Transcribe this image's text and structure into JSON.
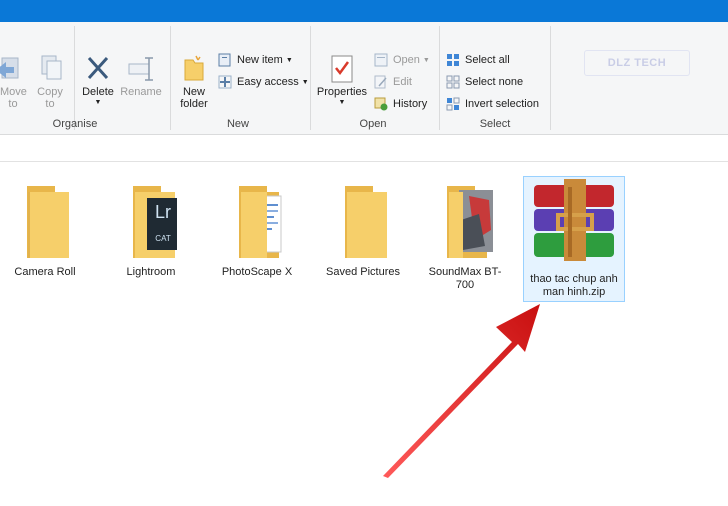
{
  "ribbon": {
    "clipboard_group": {
      "move_to": "Move to",
      "copy_to": "Copy to",
      "label": "Organise"
    },
    "organise": {
      "delete": "Delete",
      "rename": "Rename"
    },
    "new_group": {
      "new_folder": "New folder",
      "new_item": "New item",
      "easy_access": "Easy access",
      "label": "New"
    },
    "open_group": {
      "properties": "Properties",
      "open": "Open",
      "edit": "Edit",
      "history": "History",
      "label": "Open"
    },
    "select_group": {
      "select_all": "Select all",
      "select_none": "Select none",
      "invert_selection": "Invert selection",
      "label": "Select"
    }
  },
  "watermark": "DLZ TECH",
  "files": [
    {
      "name": "Camera Roll",
      "type": "folder"
    },
    {
      "name": "Lightroom",
      "type": "folder",
      "overlay": "Lr CAT"
    },
    {
      "name": "PhotoScape X",
      "type": "folder"
    },
    {
      "name": "Saved Pictures",
      "type": "folder"
    },
    {
      "name": "SoundMax BT-700",
      "type": "folder"
    },
    {
      "name": "thao tac chup anh man hinh.zip",
      "type": "winrar-archive",
      "selected": true
    }
  ],
  "lightroom_icon": {
    "big": "Lr",
    "small": "CAT"
  },
  "colors": {
    "titlebar": "#0a78d7",
    "folder": "#f6cf6a",
    "selection": "#e5f3ff",
    "arrow": "#e41e1e"
  }
}
